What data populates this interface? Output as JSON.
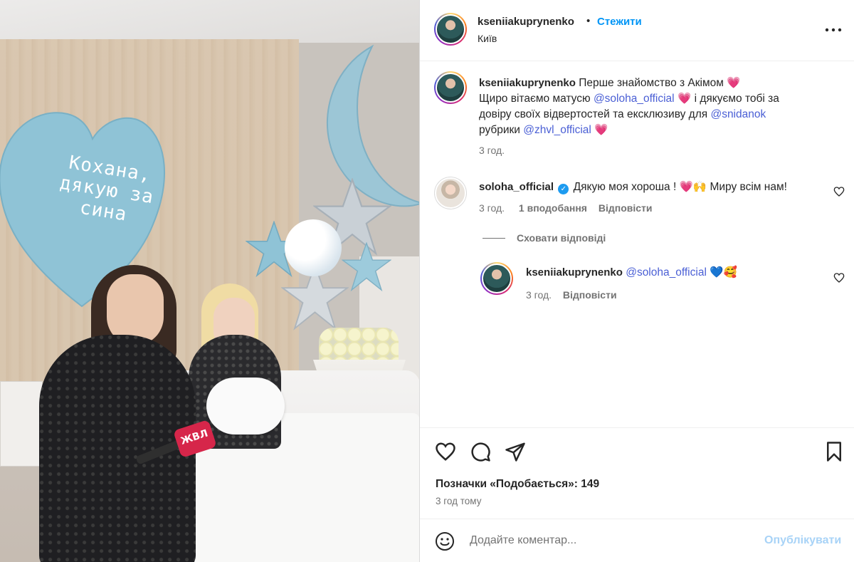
{
  "photo": {
    "balloon_text": "Кохана, дякую за сина",
    "mic_label": "ЖВЛ"
  },
  "header": {
    "username": "kseniiakuprynenko",
    "separator": "•",
    "follow_label": "Стежити",
    "location": "Київ",
    "more_icon": "more-horizontal-icon"
  },
  "caption": {
    "username": "kseniiakuprynenko",
    "line1": "Перше знайомство з Акімом",
    "line2_pre": "Щиро вітаємо матусю",
    "mention1": "@soloha_official",
    "line2_post": "і дякуємо тобі за",
    "line3_pre": "довіру своїх відвертостей та ексклюзиву для",
    "mention2": "@snidanok",
    "line4_pre": "рубрики",
    "mention3": "@zhvl_official",
    "heart": "💗",
    "time": "3 год."
  },
  "comments": [
    {
      "username": "soloha_official",
      "verified": true,
      "text": "Дякую моя хороша ! 💗🙌  Миру всім нам!",
      "time": "3 год.",
      "likes": "1 вподобання",
      "reply_label": "Відповісти"
    }
  ],
  "hide_replies_label": "Сховати відповіді",
  "replies": [
    {
      "username": "kseniiakuprynenko",
      "mention": "@soloha_official",
      "emojis": "💙🥰",
      "time": "3 год.",
      "reply_label": "Відповісти"
    }
  ],
  "actions": {
    "like_icon": "heart-icon",
    "comment_icon": "comment-icon",
    "share_icon": "share-icon",
    "save_icon": "bookmark-icon"
  },
  "likes_text": "Позначки «Подобається»: 149",
  "posted_ago": "3 год тому",
  "add_comment": {
    "placeholder": "Додайте коментар...",
    "post_label": "Опублікувати"
  },
  "colors": {
    "link": "#0095f6",
    "mention": "#4a5fd5",
    "post_disabled": "#a8d3f7",
    "balloon": "#8fc3d6"
  }
}
